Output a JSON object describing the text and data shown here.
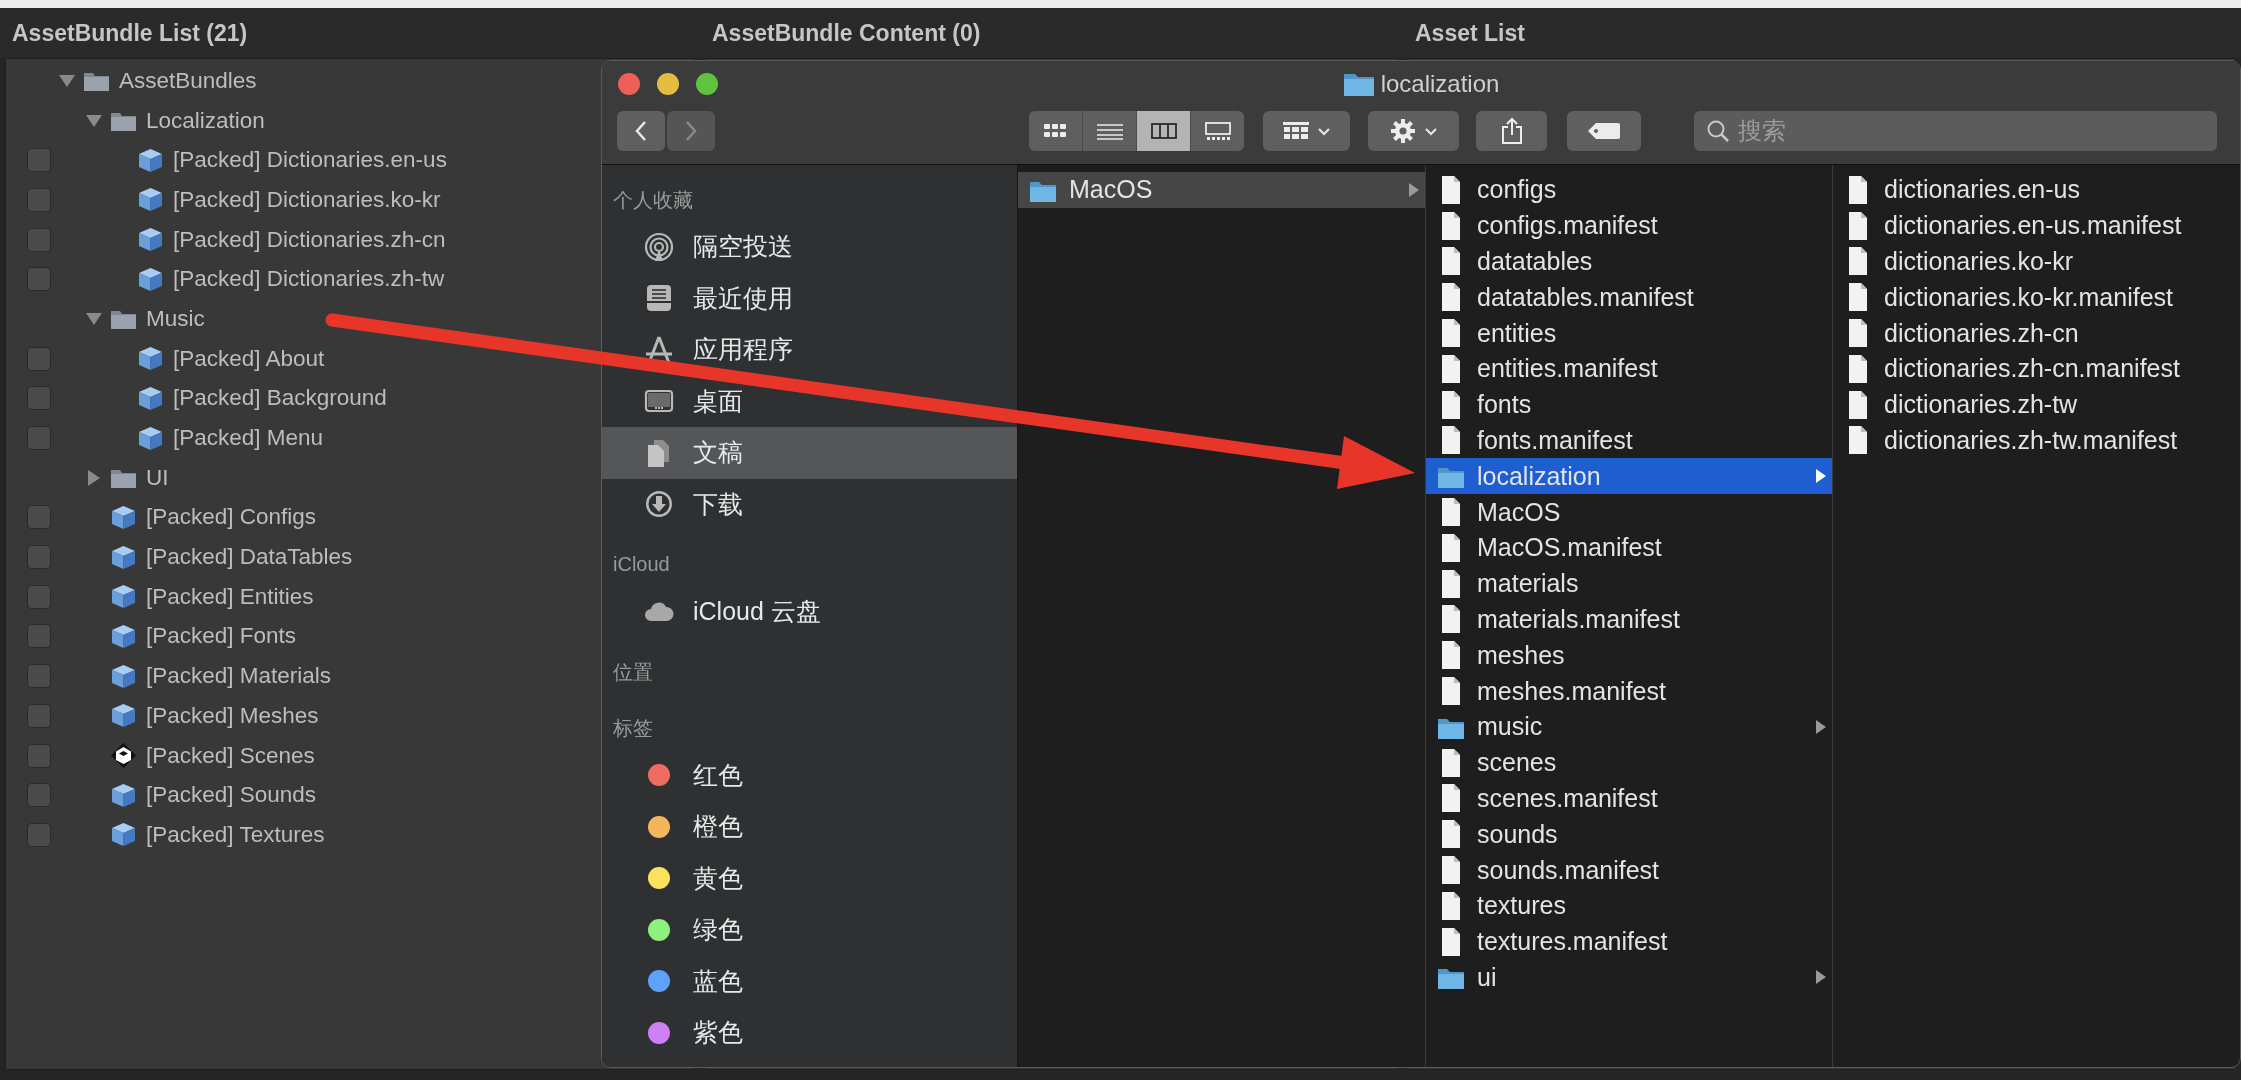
{
  "panels": [
    {
      "title": "AssetBundle List (21)"
    },
    {
      "title": "AssetBundle Content (0)"
    },
    {
      "title": "Asset List"
    }
  ],
  "tree": [
    {
      "label": "AssetBundles",
      "kind": "folder",
      "expanded": true,
      "children": [
        {
          "label": "Localization",
          "kind": "folder",
          "expanded": true,
          "children": [
            {
              "label": "[Packed] Dictionaries.en-us",
              "kind": "bundle",
              "checked": false
            },
            {
              "label": "[Packed] Dictionaries.ko-kr",
              "kind": "bundle",
              "checked": false
            },
            {
              "label": "[Packed] Dictionaries.zh-cn",
              "kind": "bundle",
              "checked": false
            },
            {
              "label": "[Packed] Dictionaries.zh-tw",
              "kind": "bundle",
              "checked": false
            }
          ]
        },
        {
          "label": "Music",
          "kind": "folder",
          "expanded": true,
          "children": [
            {
              "label": "[Packed] About",
              "kind": "bundle",
              "checked": false
            },
            {
              "label": "[Packed] Background",
              "kind": "bundle",
              "checked": false
            },
            {
              "label": "[Packed] Menu",
              "kind": "bundle",
              "checked": false
            }
          ]
        },
        {
          "label": "UI",
          "kind": "folder",
          "expanded": false
        },
        {
          "label": "[Packed] Configs",
          "kind": "bundle",
          "checked": false
        },
        {
          "label": "[Packed] DataTables",
          "kind": "bundle",
          "checked": false
        },
        {
          "label": "[Packed] Entities",
          "kind": "bundle",
          "checked": false
        },
        {
          "label": "[Packed] Fonts",
          "kind": "bundle",
          "checked": false
        },
        {
          "label": "[Packed] Materials",
          "kind": "bundle",
          "checked": false
        },
        {
          "label": "[Packed] Meshes",
          "kind": "bundle",
          "checked": false
        },
        {
          "label": "[Packed] Scenes",
          "kind": "scene",
          "checked": false
        },
        {
          "label": "[Packed] Sounds",
          "kind": "bundle",
          "checked": false
        },
        {
          "label": "[Packed] Textures",
          "kind": "bundle",
          "checked": false
        }
      ]
    }
  ],
  "finder": {
    "title": "localization",
    "view_modes": [
      {
        "kind": "icons",
        "selected": false
      },
      {
        "kind": "list",
        "selected": false
      },
      {
        "kind": "columns",
        "selected": true
      },
      {
        "kind": "gallery",
        "selected": false
      }
    ],
    "search": {
      "placeholder": "搜索"
    },
    "sidebar": [
      {
        "heading": "个人收藏",
        "items": [
          {
            "label": "隔空投送",
            "kind": "airdrop",
            "selected": false
          },
          {
            "label": "最近使用",
            "kind": "recents",
            "selected": false
          },
          {
            "label": "应用程序",
            "kind": "applications",
            "selected": false
          },
          {
            "label": "桌面",
            "kind": "desktop",
            "selected": false
          },
          {
            "label": "文稿",
            "kind": "documents",
            "selected": true
          },
          {
            "label": "下载",
            "kind": "downloads",
            "selected": false
          }
        ]
      },
      {
        "heading": "iCloud",
        "items": [
          {
            "label": "iCloud 云盘",
            "kind": "icloud",
            "selected": false
          }
        ]
      },
      {
        "heading": "位置"
      },
      {
        "heading": "标签",
        "items": [
          {
            "label": "红色",
            "kind": "tag",
            "color": "#ee6b60",
            "selected": false
          },
          {
            "label": "橙色",
            "kind": "tag",
            "color": "#f5b55c",
            "selected": false
          },
          {
            "label": "黄色",
            "kind": "tag",
            "color": "#fbe25c",
            "selected": false
          },
          {
            "label": "绿色",
            "kind": "tag",
            "color": "#8ef07d",
            "selected": false
          },
          {
            "label": "蓝色",
            "kind": "tag",
            "color": "#5ea2fb",
            "selected": false
          },
          {
            "label": "紫色",
            "kind": "tag",
            "color": "#cd7ff5",
            "selected": false
          }
        ]
      }
    ],
    "columns": [
      {
        "focused": false,
        "items": [
          {
            "name": "MacOS",
            "kind": "folder",
            "selected": true
          }
        ]
      },
      {
        "focused": true,
        "items": [
          {
            "name": "configs",
            "kind": "file",
            "selected": false
          },
          {
            "name": "configs.manifest",
            "kind": "file",
            "selected": false
          },
          {
            "name": "datatables",
            "kind": "file",
            "selected": false
          },
          {
            "name": "datatables.manifest",
            "kind": "file",
            "selected": false
          },
          {
            "name": "entities",
            "kind": "file",
            "selected": false
          },
          {
            "name": "entities.manifest",
            "kind": "file",
            "selected": false
          },
          {
            "name": "fonts",
            "kind": "file",
            "selected": false
          },
          {
            "name": "fonts.manifest",
            "kind": "file",
            "selected": false
          },
          {
            "name": "localization",
            "kind": "folder",
            "selected": true
          },
          {
            "name": "MacOS",
            "kind": "file",
            "selected": false
          },
          {
            "name": "MacOS.manifest",
            "kind": "file",
            "selected": false
          },
          {
            "name": "materials",
            "kind": "file",
            "selected": false
          },
          {
            "name": "materials.manifest",
            "kind": "file",
            "selected": false
          },
          {
            "name": "meshes",
            "kind": "file",
            "selected": false
          },
          {
            "name": "meshes.manifest",
            "kind": "file",
            "selected": false
          },
          {
            "name": "music",
            "kind": "folder",
            "selected": false
          },
          {
            "name": "scenes",
            "kind": "file",
            "selected": false
          },
          {
            "name": "scenes.manifest",
            "kind": "file",
            "selected": false
          },
          {
            "name": "sounds",
            "kind": "file",
            "selected": false
          },
          {
            "name": "sounds.manifest",
            "kind": "file",
            "selected": false
          },
          {
            "name": "textures",
            "kind": "file",
            "selected": false
          },
          {
            "name": "textures.manifest",
            "kind": "file",
            "selected": false
          },
          {
            "name": "ui",
            "kind": "folder",
            "selected": false
          }
        ]
      },
      {
        "items": [
          {
            "name": "dictionaries.en-us",
            "kind": "file",
            "selected": false
          },
          {
            "name": "dictionaries.en-us.manifest",
            "kind": "file",
            "selected": false
          },
          {
            "name": "dictionaries.ko-kr",
            "kind": "file",
            "selected": false
          },
          {
            "name": "dictionaries.ko-kr.manifest",
            "kind": "file",
            "selected": false
          },
          {
            "name": "dictionaries.zh-cn",
            "kind": "file",
            "selected": false
          },
          {
            "name": "dictionaries.zh-cn.manifest",
            "kind": "file",
            "selected": false
          },
          {
            "name": "dictionaries.zh-tw",
            "kind": "file",
            "selected": false
          },
          {
            "name": "dictionaries.zh-tw.manifest",
            "kind": "file",
            "selected": false
          }
        ]
      }
    ]
  }
}
